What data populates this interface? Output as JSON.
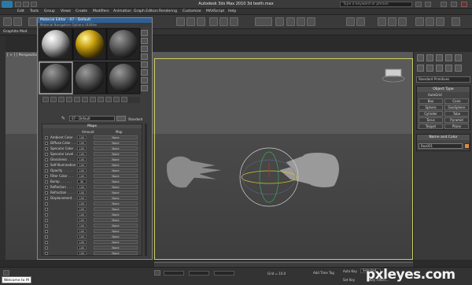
{
  "window": {
    "title": "Autodesk 3ds Max  2010      3d teeth.max",
    "search_placeholder": "Type a keyword or phrase"
  },
  "menu": [
    "Edit",
    "Tools",
    "Group",
    "Views",
    "Create",
    "Modifiers",
    "Animation",
    "Graph Editors",
    "Rendering",
    "Customize",
    "MAXScript",
    "Help"
  ],
  "ribbon": {
    "label": "Graphite Mod"
  },
  "viewport": {
    "label": "[ + ] [ Perspective ] [ Smooth + Highlights ]"
  },
  "material_editor": {
    "title": "Material Editor - 07 - Default",
    "menu": "Material  Navigation  Options  Utilities",
    "material_name": "07 - Default",
    "material_type": "Standard",
    "maps_title": "Maps",
    "amount_header": "Amount",
    "map_header": "Map",
    "map_rows": [
      {
        "label": "Ambient Color . .",
        "amount": "100",
        "map": "None"
      },
      {
        "label": "Diffuse Color . . .",
        "amount": "100",
        "map": "None"
      },
      {
        "label": "Specular Color . .",
        "amount": "100",
        "map": "None"
      },
      {
        "label": "Specular Level . .",
        "amount": "100",
        "map": "None"
      },
      {
        "label": "Glossiness . . . .",
        "amount": "100",
        "map": "None"
      },
      {
        "label": "Self-Illumination .",
        "amount": "100",
        "map": "None"
      },
      {
        "label": "Opacity . . . . .",
        "amount": "100",
        "map": "None"
      },
      {
        "label": "Filter Color . . .",
        "amount": "100",
        "map": "None"
      },
      {
        "label": "Bump . . . . . .",
        "amount": "30",
        "map": "None"
      },
      {
        "label": "Reflection . . . .",
        "amount": "100",
        "map": "None"
      },
      {
        "label": "Refraction . . . .",
        "amount": "100",
        "map": "None"
      },
      {
        "label": "Displacement . . .",
        "amount": "100",
        "map": "None"
      },
      {
        "label": "",
        "amount": "100",
        "map": "None"
      },
      {
        "label": "",
        "amount": "100",
        "map": "None"
      },
      {
        "label": "",
        "amount": "100",
        "map": "None"
      },
      {
        "label": "",
        "amount": "100",
        "map": "None"
      },
      {
        "label": "",
        "amount": "100",
        "map": "None"
      },
      {
        "label": "",
        "amount": "100",
        "map": "None"
      },
      {
        "label": "",
        "amount": "100",
        "map": "None"
      },
      {
        "label": "",
        "amount": "100",
        "map": "None"
      },
      {
        "label": "",
        "amount": "100",
        "map": "None"
      },
      {
        "label": "",
        "amount": "100",
        "map": "None"
      }
    ]
  },
  "command_panel": {
    "dropdown": "Standard Primitives",
    "object_type_title": "Object Type",
    "autogrid": "AutoGrid",
    "buttons": [
      "Box",
      "Cone",
      "Sphere",
      "GeoSphere",
      "Cylinder",
      "Tube",
      "Torus",
      "Pyramid",
      "Teapot",
      "Plane"
    ],
    "name_color_title": "Name and Color",
    "object_name": "Box001",
    "swatch_color": "#e08a3c"
  },
  "status": {
    "listener": "Welcome to M",
    "grid": "Grid = 10.0",
    "auto_key": "Auto Key",
    "selected": "Selected",
    "set_key": "Set Key",
    "key_filters": "Key Filters...",
    "add_time_tag": "Add Time Tag"
  },
  "watermark": "pxleyes.com"
}
